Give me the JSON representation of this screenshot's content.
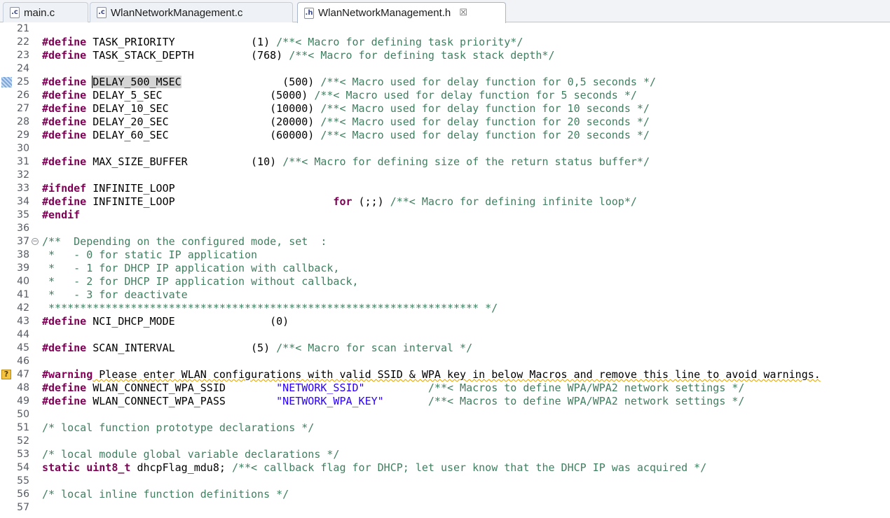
{
  "tabs": [
    {
      "label": "main.c",
      "icon": ".c",
      "active": false
    },
    {
      "label": "WlanNetworkManagement.c",
      "icon": ".c",
      "active": false
    },
    {
      "label": "WlanNetworkManagement.h",
      "icon": ".h",
      "active": true,
      "close": "☒"
    }
  ],
  "colors": {
    "keyword": "#7f0055",
    "comment": "#3f7f5f",
    "string": "#2a00ff",
    "highlight": "#d4d4d4"
  },
  "lines": [
    {
      "n": "21",
      "segs": []
    },
    {
      "n": "22",
      "segs": [
        {
          "t": "kw",
          "v": "#define"
        },
        {
          "t": "tx",
          "v": " TASK_PRIORITY            (1) "
        },
        {
          "t": "cm",
          "v": "/**< Macro for defining task priority*/"
        }
      ]
    },
    {
      "n": "23",
      "segs": [
        {
          "t": "kw",
          "v": "#define"
        },
        {
          "t": "tx",
          "v": " TASK_STACK_DEPTH         (768) "
        },
        {
          "t": "cm",
          "v": "/**< Macro for defining task stack depth*/"
        }
      ]
    },
    {
      "n": "24",
      "segs": []
    },
    {
      "n": "25",
      "marker": "bookmark",
      "segs": [
        {
          "t": "kw",
          "v": "#define"
        },
        {
          "t": "tx",
          "v": " "
        },
        {
          "t": "hl",
          "v": "DE"
        },
        {
          "t": "hlc",
          "v": "LAY_500_MSEC"
        },
        {
          "t": "tx",
          "v": "                (500) "
        },
        {
          "t": "cm",
          "v": "/**< Macro used for delay function for 0,5 seconds */"
        }
      ]
    },
    {
      "n": "26",
      "segs": [
        {
          "t": "kw",
          "v": "#define"
        },
        {
          "t": "tx",
          "v": " DELAY_5_SEC                 (5000) "
        },
        {
          "t": "cm",
          "v": "/**< Macro used for delay function for 5 seconds */"
        }
      ]
    },
    {
      "n": "27",
      "segs": [
        {
          "t": "kw",
          "v": "#define"
        },
        {
          "t": "tx",
          "v": " DELAY_10_SEC                (10000) "
        },
        {
          "t": "cm",
          "v": "/**< Macro used for delay function for 10 seconds */"
        }
      ]
    },
    {
      "n": "28",
      "segs": [
        {
          "t": "kw",
          "v": "#define"
        },
        {
          "t": "tx",
          "v": " DELAY_20_SEC                (20000) "
        },
        {
          "t": "cm",
          "v": "/**< Macro used for delay function for 20 seconds */"
        }
      ]
    },
    {
      "n": "29",
      "segs": [
        {
          "t": "kw",
          "v": "#define"
        },
        {
          "t": "tx",
          "v": " DELAY_60_SEC                (60000) "
        },
        {
          "t": "cm",
          "v": "/**< Macro used for delay function for 20 seconds */"
        }
      ]
    },
    {
      "n": "30",
      "segs": []
    },
    {
      "n": "31",
      "segs": [
        {
          "t": "kw",
          "v": "#define"
        },
        {
          "t": "tx",
          "v": " MAX_SIZE_BUFFER          (10) "
        },
        {
          "t": "cm",
          "v": "/**< Macro for defining size of the return status buffer*/"
        }
      ]
    },
    {
      "n": "32",
      "segs": []
    },
    {
      "n": "33",
      "segs": [
        {
          "t": "kw",
          "v": "#ifndef"
        },
        {
          "t": "tx",
          "v": " INFINITE_LOOP"
        }
      ]
    },
    {
      "n": "34",
      "segs": [
        {
          "t": "kw",
          "v": "#define"
        },
        {
          "t": "tx",
          "v": " INFINITE_LOOP                         "
        },
        {
          "t": "kw",
          "v": "for"
        },
        {
          "t": "tx",
          "v": " (;;) "
        },
        {
          "t": "cm",
          "v": "/**< Macro for defining infinite loop*/"
        }
      ]
    },
    {
      "n": "35",
      "segs": [
        {
          "t": "kw",
          "v": "#endif"
        }
      ]
    },
    {
      "n": "36",
      "segs": []
    },
    {
      "n": "37",
      "marker": "fold",
      "segs": [
        {
          "t": "cm",
          "v": "/**  Depending on the configured mode, set  :"
        }
      ]
    },
    {
      "n": "38",
      "segs": [
        {
          "t": "cm",
          "v": " *   - 0 for static IP application"
        }
      ]
    },
    {
      "n": "39",
      "segs": [
        {
          "t": "cm",
          "v": " *   - 1 for DHCP IP application with callback,"
        }
      ]
    },
    {
      "n": "40",
      "segs": [
        {
          "t": "cm",
          "v": " *   - 2 for DHCP IP application without callback,"
        }
      ]
    },
    {
      "n": "41",
      "segs": [
        {
          "t": "cm",
          "v": " *   - 3 for deactivate"
        }
      ]
    },
    {
      "n": "42",
      "segs": [
        {
          "t": "cm",
          "v": " ******************************************************************** */"
        }
      ]
    },
    {
      "n": "43",
      "segs": [
        {
          "t": "kw",
          "v": "#define"
        },
        {
          "t": "tx",
          "v": " NCI_DHCP_MODE               (0)"
        }
      ]
    },
    {
      "n": "44",
      "segs": []
    },
    {
      "n": "45",
      "segs": [
        {
          "t": "kw",
          "v": "#define"
        },
        {
          "t": "tx",
          "v": " SCAN_INTERVAL            (5) "
        },
        {
          "t": "cm",
          "v": "/**< Macro for scan interval */"
        }
      ]
    },
    {
      "n": "46",
      "segs": []
    },
    {
      "n": "47",
      "marker": "warning",
      "segs": [
        {
          "t": "kw",
          "v": "#warning"
        },
        {
          "t": "wu",
          "v": " Please enter WLAN configurations with valid SSID & WPA key in below Macros and remove this line to avoid warnings."
        }
      ]
    },
    {
      "n": "48",
      "segs": [
        {
          "t": "kw",
          "v": "#define"
        },
        {
          "t": "tx",
          "v": " WLAN_CONNECT_WPA_SSID        "
        },
        {
          "t": "str",
          "v": "\"NETWORK_SSID\""
        },
        {
          "t": "tx",
          "v": "          "
        },
        {
          "t": "cm",
          "v": "/**< Macros to define WPA/WPA2 network settings */"
        }
      ]
    },
    {
      "n": "49",
      "segs": [
        {
          "t": "kw",
          "v": "#define"
        },
        {
          "t": "tx",
          "v": " WLAN_CONNECT_WPA_PASS        "
        },
        {
          "t": "str",
          "v": "\"NETWORK_WPA_KEY\""
        },
        {
          "t": "tx",
          "v": "       "
        },
        {
          "t": "cm",
          "v": "/**< Macros to define WPA/WPA2 network settings */"
        }
      ]
    },
    {
      "n": "50",
      "segs": []
    },
    {
      "n": "51",
      "segs": [
        {
          "t": "cm",
          "v": "/* local function prototype declarations */"
        }
      ]
    },
    {
      "n": "52",
      "segs": []
    },
    {
      "n": "53",
      "segs": [
        {
          "t": "cm",
          "v": "/* local module global variable declarations */"
        }
      ]
    },
    {
      "n": "54",
      "segs": [
        {
          "t": "kw",
          "v": "static"
        },
        {
          "t": "tx",
          "v": " "
        },
        {
          "t": "kw",
          "v": "uint8_t"
        },
        {
          "t": "tx",
          "v": " dhcpFlag_mdu8; "
        },
        {
          "t": "cm",
          "v": "/**< callback flag for DHCP; let user know that the DHCP IP was acquired */"
        }
      ]
    },
    {
      "n": "55",
      "segs": []
    },
    {
      "n": "56",
      "segs": [
        {
          "t": "cm",
          "v": "/* local inline function definitions */"
        }
      ]
    },
    {
      "n": "57",
      "segs": []
    }
  ]
}
